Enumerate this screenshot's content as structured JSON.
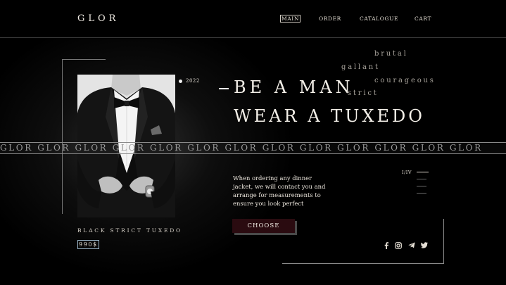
{
  "brand": {
    "logo": "GLOR"
  },
  "nav": {
    "items": [
      "MAIN",
      "ORDER",
      "CATALOGUE",
      "CART"
    ],
    "active": "MAIN"
  },
  "hero": {
    "year": "2022",
    "headline_line1": "BE A MAN",
    "headline_line2": "WEAR A TUXEDO",
    "words": [
      "brutal",
      "gallant",
      "courageous",
      "strict"
    ],
    "description": "When ordering any dinner jacket, we will contact you and arrange for measurements to ensure you look perfect",
    "cta_label": "CHOOSE"
  },
  "marquee": {
    "text": "GLOR GLOR GLOR GLOR GLOR GLOR GLOR GLOR GLOR GLOR GLOR GLOR GLOR"
  },
  "pagination": {
    "label": "I/IV",
    "current": 1,
    "total": 4
  },
  "product": {
    "name": "BLACK STRICT TUXEDO",
    "price": "990$"
  },
  "social": {
    "icons": [
      "facebook-icon",
      "instagram-icon",
      "telegram-icon",
      "twitter-icon"
    ]
  },
  "colors": {
    "background": "#000000",
    "accent": "#2a0b10",
    "text": "#f3efe8",
    "price_border": "#9bb6c9"
  }
}
